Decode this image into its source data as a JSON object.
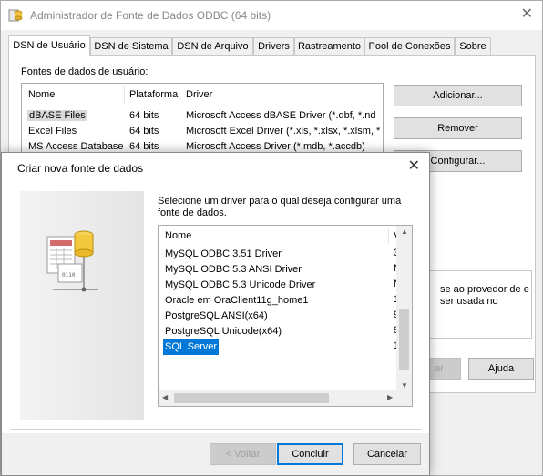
{
  "window": {
    "title": "Administrador de Fonte de Dados ODBC (64 bits)",
    "close_glyph": "✕"
  },
  "tabs": [
    {
      "label": "DSN de Usuário",
      "active": true
    },
    {
      "label": "DSN de Sistema"
    },
    {
      "label": "DSN de Arquivo"
    },
    {
      "label": "Drivers"
    },
    {
      "label": "Rastreamento"
    },
    {
      "label": "Pool de Conexões"
    },
    {
      "label": "Sobre"
    }
  ],
  "user_dsn": {
    "label": "Fontes de dados de usuário:",
    "columns": [
      "Nome",
      "Plataforma",
      "Driver"
    ],
    "rows": [
      {
        "name": "dBASE Files",
        "platform": "64 bits",
        "driver": "Microsoft Access dBASE Driver (*.dbf, *.nd"
      },
      {
        "name": "Excel Files",
        "platform": "64 bits",
        "driver": "Microsoft Excel Driver (*.xls, *.xlsx, *.xlsm, *"
      },
      {
        "name": "MS Access Database",
        "platform": "64 bits",
        "driver": "Microsoft Access Driver (*.mdb, *.accdb)"
      }
    ],
    "buttons": {
      "add": "Adicionar...",
      "remove": "Remover",
      "configure": "Configurar..."
    },
    "info_text": "se ao provedor de e ser usada no",
    "bottom_buttons": {
      "partial_disabled": "ar",
      "help": "Ajuda"
    }
  },
  "dialog": {
    "title": "Criar nova fonte de dados",
    "close_glyph": "✕",
    "instruction": "Selecione um driver para o qual deseja configurar uma fonte de dados.",
    "list_header": {
      "name": "Nome",
      "version": "V"
    },
    "drivers": [
      {
        "name": "MySQL ODBC 3.51 Driver",
        "version": "3"
      },
      {
        "name": "MySQL ODBC 5.3 ANSI Driver",
        "version": "N"
      },
      {
        "name": "MySQL ODBC 5.3 Unicode Driver",
        "version": "N"
      },
      {
        "name": "Oracle em OraClient11g_home1",
        "version": "1"
      },
      {
        "name": "PostgreSQL ANSI(x64)",
        "version": "9"
      },
      {
        "name": "PostgreSQL Unicode(x64)",
        "version": "9"
      },
      {
        "name": "SQL Server",
        "version": "1",
        "selected": true
      }
    ],
    "buttons": {
      "back": "< Voltar",
      "finish": "Concluir",
      "cancel": "Cancelar"
    }
  },
  "icons": {
    "app": "odbc-app-icon",
    "wizard": "database-driver-icon"
  },
  "colors": {
    "selection": "#0078d7",
    "default_button_border": "#0078d7"
  }
}
